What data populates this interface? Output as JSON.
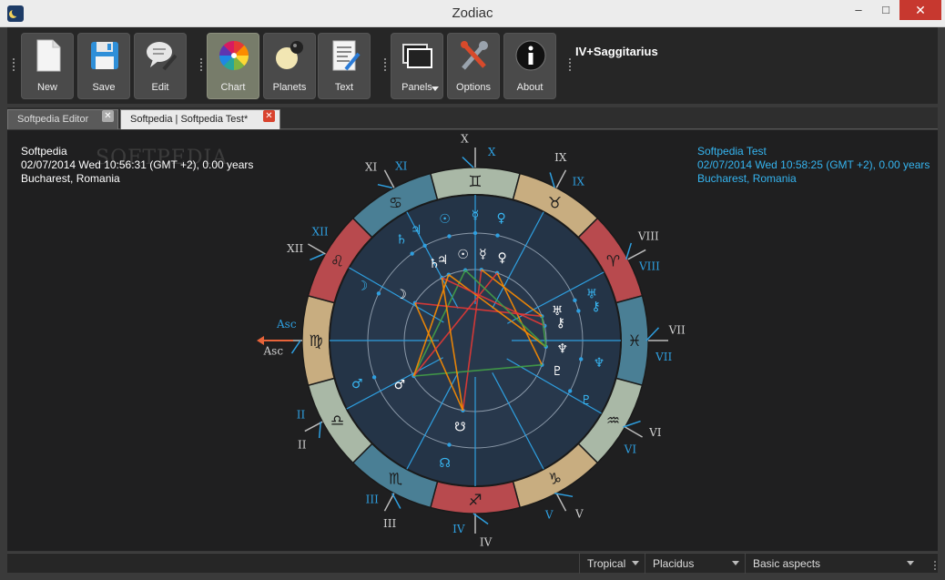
{
  "window": {
    "title": "Zodiac",
    "minimize": "–",
    "maximize": "□",
    "close": "✕"
  },
  "toolbar": {
    "buttons": [
      {
        "label": "New",
        "icon": "new-document-icon"
      },
      {
        "label": "Save",
        "icon": "floppy-disk-icon"
      },
      {
        "label": "Edit",
        "icon": "speech-bubble-pencil-icon"
      },
      {
        "label": "Chart",
        "icon": "color-wheel-icon"
      },
      {
        "label": "Planets",
        "icon": "planet-icon"
      },
      {
        "label": "Text",
        "icon": "text-document-icon"
      },
      {
        "label": "Panels",
        "icon": "panels-icon"
      },
      {
        "label": "Options",
        "icon": "tools-icon"
      },
      {
        "label": "About",
        "icon": "info-icon"
      }
    ],
    "caption": "IV+Saggitarius"
  },
  "tabs": [
    {
      "label": "Softpedia Editor"
    },
    {
      "label": "Softpedia | Softpedia Test*"
    }
  ],
  "info_left": {
    "name": "Softpedia",
    "datetime": "02/07/2014 Wed 10:56:31 (GMT +2),  0.00 years",
    "place": "Bucharest, Romania"
  },
  "info_right": {
    "name": "Softpedia Test",
    "datetime": "02/07/2014 Wed 10:58:25 (GMT +2),  0.00 years",
    "place": "Bucharest, Romania"
  },
  "watermark": "SOFTPEDIA",
  "chart": {
    "signs": [
      "♋",
      "♊",
      "♉",
      "♈",
      "♓",
      "♒",
      "♑",
      "♐",
      "♏",
      "♎",
      "♍",
      "♌"
    ],
    "houses": [
      "X",
      "IX",
      "VIII",
      "VII",
      "VI",
      "V",
      "IV",
      "III",
      "II",
      "Asc",
      "XII",
      "XI"
    ],
    "asc_label": "Asc",
    "planets_inner": [
      "☉",
      "☿",
      "♀",
      "♃",
      "♄",
      "☽",
      "♂",
      "♅",
      "♆",
      "⚷",
      "♇",
      "☋"
    ],
    "planets_outer": [
      "☉",
      "☿",
      "♀",
      "♃",
      "♄",
      "☽",
      "♂",
      "♅",
      "♆",
      "⚷",
      "♇",
      "☊"
    ]
  },
  "status": {
    "zodiac": "Tropical",
    "houses": "Placidus",
    "aspects": "Basic aspects"
  }
}
